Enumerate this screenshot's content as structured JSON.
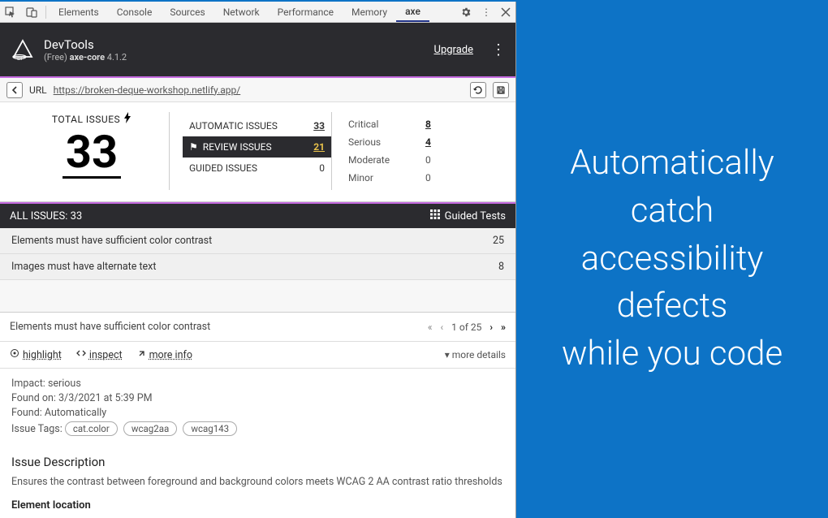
{
  "devtools_tabs": {
    "items": [
      "Elements",
      "Console",
      "Sources",
      "Network",
      "Performance",
      "Memory",
      "axe"
    ],
    "active": "axe"
  },
  "header": {
    "title": "DevTools",
    "subtitle_prefix": "(Free) ",
    "subtitle_core": "axe-core",
    "subtitle_version": " 4.1.2",
    "upgrade": "Upgrade"
  },
  "url": {
    "label": "URL",
    "value": "https://broken-deque-workshop.netlify.app/"
  },
  "summary": {
    "total_label": "TOTAL ISSUES",
    "total_value": "33",
    "types": [
      {
        "label": "AUTOMATIC ISSUES",
        "count": "33",
        "active": false
      },
      {
        "label": "REVIEW ISSUES",
        "count": "21",
        "active": true
      },
      {
        "label": "GUIDED ISSUES",
        "count": "0",
        "active": false
      }
    ],
    "severity": [
      {
        "label": "Critical",
        "count": "8",
        "link": true
      },
      {
        "label": "Serious",
        "count": "4",
        "link": true
      },
      {
        "label": "Moderate",
        "count": "0",
        "link": false
      },
      {
        "label": "Minor",
        "count": "0",
        "link": false
      }
    ]
  },
  "issuesbar": {
    "label_prefix": "ALL ISSUES: ",
    "count": "33",
    "guided": "Guided Tests"
  },
  "issues": [
    {
      "title": "Elements must have sufficient color contrast",
      "count": "25"
    },
    {
      "title": "Images must have alternate text",
      "count": "8"
    }
  ],
  "detail": {
    "title": "Elements must have sufficient color contrast",
    "pager": {
      "pos": "1",
      "of": "of",
      "total": "25"
    },
    "tools": {
      "highlight": "highlight",
      "inspect": "inspect",
      "moreinfo": "more info",
      "moredetails": "more details"
    },
    "meta": {
      "impact_label": "Impact: ",
      "impact_value": "serious",
      "found_on_label": "Found on: ",
      "found_on_value": "3/3/2021 at 5:39 PM",
      "found_label": "Found: ",
      "found_value": "Automatically",
      "tags_label": "Issue Tags: ",
      "tags": [
        "cat.color",
        "wcag2aa",
        "wcag143"
      ]
    },
    "description": {
      "heading": "Issue Description",
      "text": "Ensures the contrast between foreground and background colors meets WCAG 2 AA contrast ratio thresholds",
      "location_heading": "Element location"
    }
  },
  "marketing": {
    "line1": "Automatically",
    "line2": "catch",
    "line3": "accessibility",
    "line4": "defects",
    "line5": "while you code"
  }
}
